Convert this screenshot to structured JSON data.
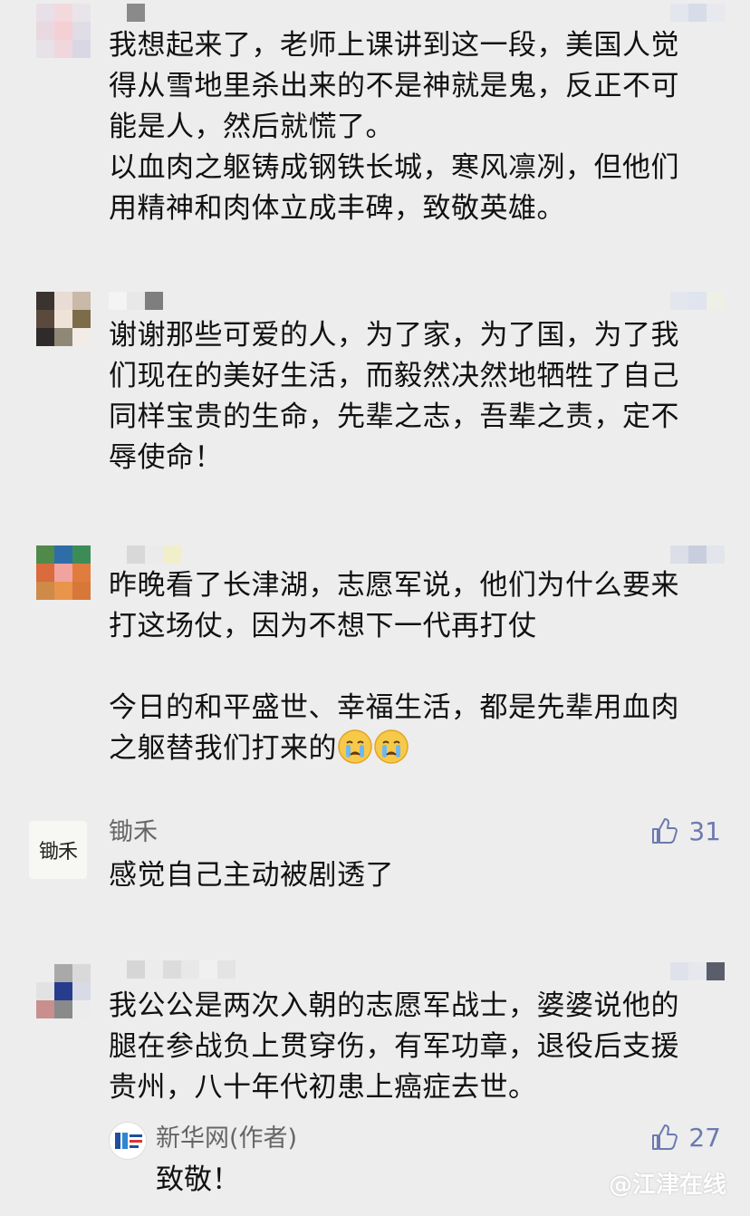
{
  "comments": [
    {
      "text": "我想起来了，老师上课讲到这一段，美国人觉\n得从雪地里杀出来的不是神就是鬼，反正不可\n能是人，然后就慌了。\n以血肉之躯铸成钢铁长城，寒风凛冽，但他们\n用精神和肉体立成丰碑，致敬英雄。"
    },
    {
      "text": "谢谢那些可爱的人，为了家，为了国，为了我\n们现在的美好生活，而毅然决然地牺牲了自己\n同样宝贵的生命，先辈之志，吾辈之责，定不\n辱使命！"
    },
    {
      "text": "昨晚看了长津湖，志愿军说，他们为什么要来\n打这场仗，因为不想下一代再打仗\n\n今日的和平盛世、幸福生活，都是先辈用血肉\n之躯替我们打来的"
    },
    {
      "avatar_text": "锄禾",
      "username": "锄禾",
      "likes": "31",
      "text": "感觉自己主动被剧透了"
    },
    {
      "text": "我公公是两次入朝的志愿军战士，婆婆说他的\n腿在参战负上贯穿伤，有军功章，退役后支援\n贵州，八十年代初患上癌症去世。",
      "reply": {
        "author": "新华网(作者)",
        "likes": "27",
        "text": "致敬！"
      }
    }
  ],
  "watermark": "@江津在线",
  "icons": {
    "like": "thumbs-up-icon",
    "emoji": "crying-face-emoji"
  },
  "colors": {
    "background": "#ededed",
    "like": "#6b7ab0",
    "username": "#666666"
  }
}
